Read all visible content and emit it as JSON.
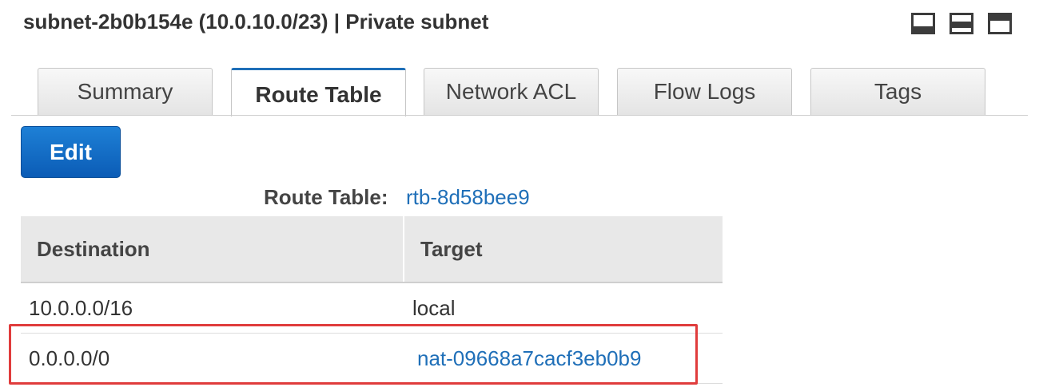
{
  "header": {
    "title": "subnet-2b0b154e (10.0.10.0/23) | Private subnet"
  },
  "panel_icons": [
    "panel-bottom-icon",
    "panel-split-icon",
    "panel-top-icon"
  ],
  "tabs": [
    {
      "label": "Summary",
      "active": false
    },
    {
      "label": "Route Table",
      "active": true
    },
    {
      "label": "Network ACL",
      "active": false
    },
    {
      "label": "Flow Logs",
      "active": false
    },
    {
      "label": "Tags",
      "active": false
    }
  ],
  "toolbar": {
    "edit_label": "Edit"
  },
  "route_table": {
    "label": "Route Table:",
    "id": "rtb-8d58bee9",
    "columns": [
      "Destination",
      "Target"
    ],
    "rows": [
      {
        "destination": "10.0.0.0/16",
        "target": "local",
        "target_is_link": false
      },
      {
        "destination": "0.0.0.0/0",
        "target": "nat-09668a7cacf3eb0b9",
        "target_is_link": true
      }
    ]
  },
  "colors": {
    "accent": "#1f6fb8",
    "highlight": "#e03c3c",
    "button": "#0b5cb6"
  }
}
